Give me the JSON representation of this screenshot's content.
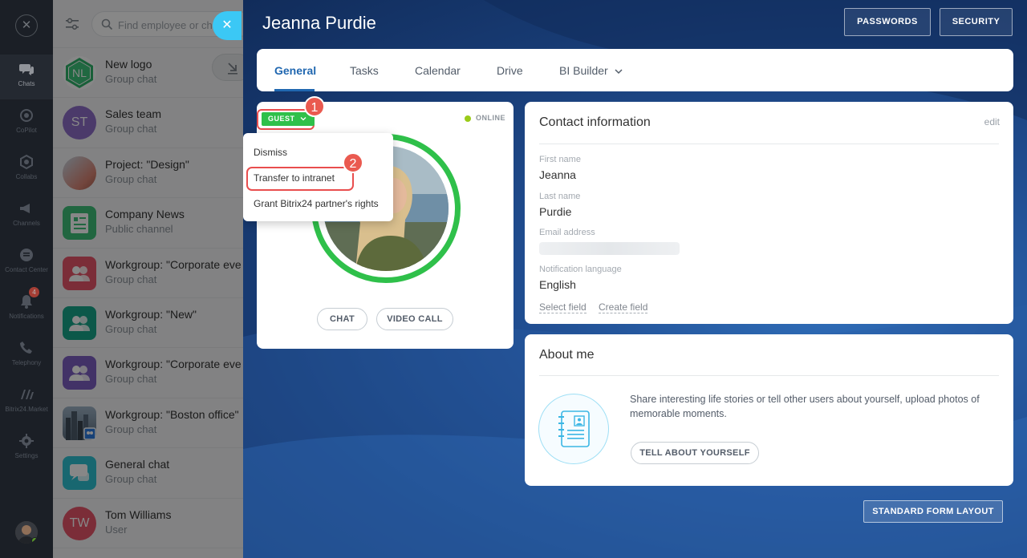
{
  "rail": {
    "items": [
      {
        "label": "Chats",
        "icon": "chats-icon"
      },
      {
        "label": "CoPilot",
        "icon": "copilot-icon"
      },
      {
        "label": "Collabs",
        "icon": "collabs-icon"
      },
      {
        "label": "Channels",
        "icon": "channels-icon"
      },
      {
        "label": "Contact Center",
        "icon": "contact-center-icon"
      },
      {
        "label": "Notifications",
        "icon": "bell-icon"
      },
      {
        "label": "Telephony",
        "icon": "phone-icon"
      },
      {
        "label": "Bitrix24.Market",
        "icon": "market-icon"
      },
      {
        "label": "Settings",
        "icon": "gear-icon"
      }
    ],
    "notification_count": "4"
  },
  "chatlist": {
    "search_placeholder": "Find employee or chat",
    "chats": [
      {
        "initials": "NL",
        "name": "New logo",
        "subtitle": "Group chat",
        "color": "#ffffff"
      },
      {
        "initials": "ST",
        "name": "Sales team",
        "subtitle": "Group chat",
        "color": "#8e6fc9"
      },
      {
        "initials": "",
        "name": "Project: \"Design\"",
        "subtitle": "Group chat",
        "color": "#d98575"
      },
      {
        "initials": "",
        "name": "Company News",
        "subtitle": "Public channel",
        "color": "#3fc17a"
      },
      {
        "initials": "",
        "name": "Workgroup: \"Corporate eve",
        "subtitle": "Group chat",
        "color": "#e8566b"
      },
      {
        "initials": "",
        "name": "Workgroup: \"New\"",
        "subtitle": "Group chat",
        "color": "#18a68a"
      },
      {
        "initials": "",
        "name": "Workgroup: \"Corporate eve",
        "subtitle": "Group chat",
        "color": "#7d5fc3"
      },
      {
        "initials": "",
        "name": "Workgroup: \"Boston office\"",
        "subtitle": "Group chat",
        "color": "#6d8aa6"
      },
      {
        "initials": "",
        "name": "General chat",
        "subtitle": "Group chat",
        "color": "#2fc3d4"
      },
      {
        "initials": "TW",
        "name": "Tom Williams",
        "subtitle": "User",
        "color": "#e8566b"
      }
    ]
  },
  "header": {
    "title": "Jeanna Purdie",
    "passwords_label": "PASSWORDS",
    "security_label": "SECURITY"
  },
  "tabs": [
    {
      "label": "General"
    },
    {
      "label": "Tasks"
    },
    {
      "label": "Calendar"
    },
    {
      "label": "Drive"
    },
    {
      "label": "BI Builder"
    }
  ],
  "profile": {
    "guest_label": "GUEST",
    "status": "ONLINE",
    "chat_label": "CHAT",
    "video_call_label": "VIDEO CALL",
    "step1": "1",
    "step2": "2",
    "menu": [
      "Dismiss",
      "Transfer to intranet",
      "Grant Bitrix24 partner's rights"
    ]
  },
  "contact": {
    "title": "Contact information",
    "edit": "edit",
    "first_name_label": "First name",
    "first_name": "Jeanna",
    "last_name_label": "Last name",
    "last_name": "Purdie",
    "email_label": "Email address",
    "language_label": "Notification language",
    "language": "English",
    "select_field": "Select field",
    "create_field": "Create field"
  },
  "about": {
    "title": "About me",
    "text": "Share interesting life stories or tell other users about yourself, upload photos of memorable moments.",
    "button": "TELL ABOUT YOURSELF"
  },
  "footer": {
    "standard_form_layout": "STANDARD FORM LAYOUT"
  },
  "colors": {
    "accent": "#2067b0",
    "online": "#2fc04a",
    "highlight": "#e94e4e"
  }
}
